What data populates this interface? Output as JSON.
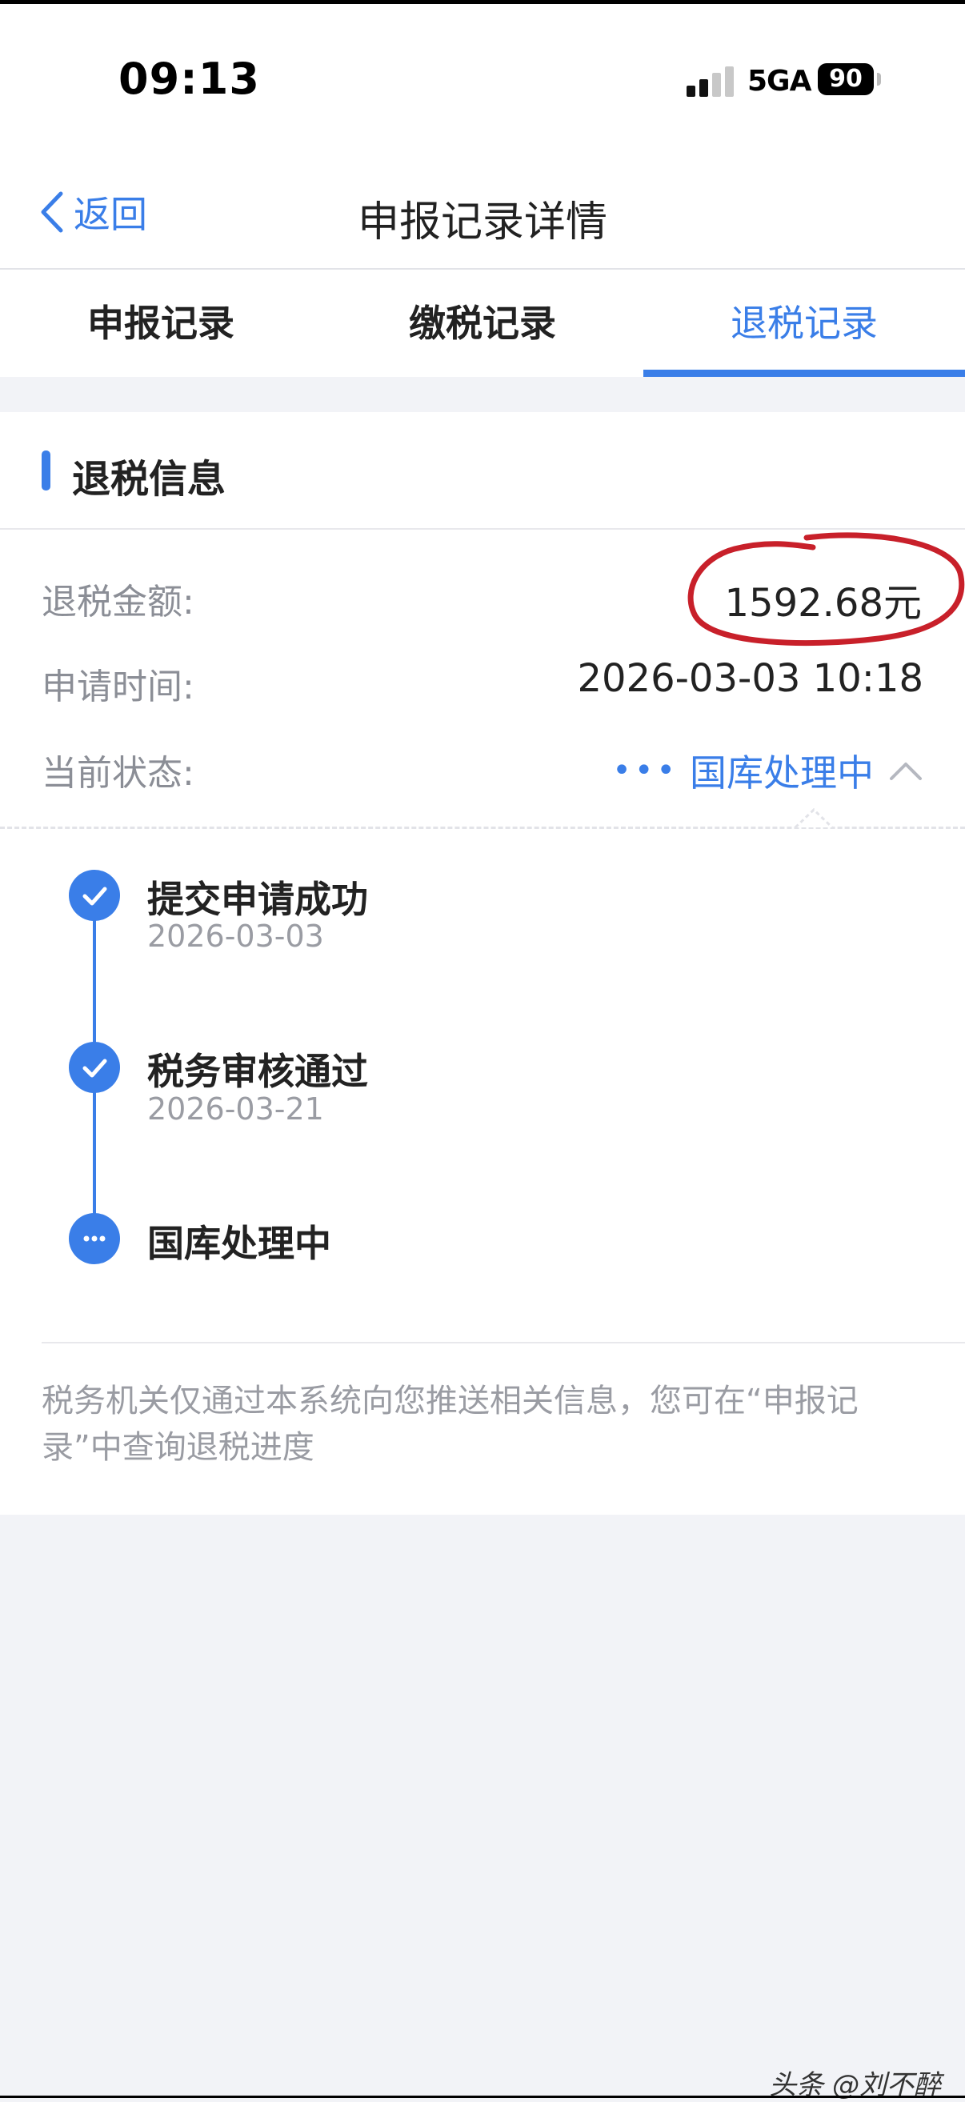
{
  "status_bar": {
    "time": "09:13",
    "network": "5GA",
    "battery": "90"
  },
  "nav": {
    "back_label": "返回",
    "title": "申报记录详情"
  },
  "tabs": [
    {
      "label": "申报记录",
      "active": false
    },
    {
      "label": "缴税记录",
      "active": false
    },
    {
      "label": "退税记录",
      "active": true
    }
  ],
  "refund_info": {
    "section_title": "退税信息",
    "amount_label": "退税金额:",
    "amount_value": "1592.68元",
    "apply_time_label": "申请时间:",
    "apply_time_value": "2026-03-03 10:18",
    "status_label": "当前状态:",
    "status_value": "国库处理中"
  },
  "timeline": [
    {
      "title": "提交申请成功",
      "date": "2026-03-03",
      "state": "done",
      "icon": "check-icon"
    },
    {
      "title": "税务审核通过",
      "date": "2026-03-21",
      "state": "done",
      "icon": "check-icon"
    },
    {
      "title": "国库处理中",
      "date": "",
      "state": "in-progress",
      "icon": "more-dots-icon"
    }
  ],
  "footer_note": "税务机关仅通过本系统向您推送相关信息，您可在“申报记录”中查询退税进度",
  "watermark": "头条 @刘不醉",
  "colors": {
    "accent": "#3a7ee8",
    "annotation_red": "#c8202a",
    "label_gray": "#8b8e96",
    "background": "#f2f3f7"
  }
}
